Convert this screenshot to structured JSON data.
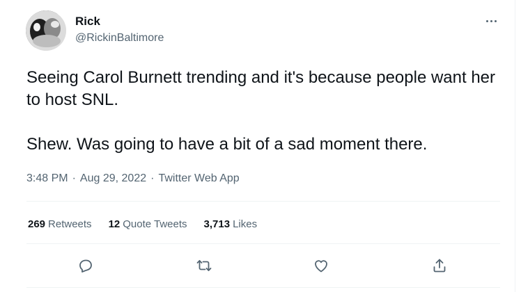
{
  "author": {
    "name": "Rick",
    "handle": "@RickinBaltimore"
  },
  "tweet": {
    "text": "Seeing Carol Burnett trending and it's because people want her to host SNL.\n\nShew. Was going to have a bit of a sad moment there.",
    "time": "3:48 PM",
    "date": "Aug 29, 2022",
    "source": "Twitter Web App",
    "separator": "·"
  },
  "stats": {
    "retweets_count": "269",
    "retweets_label": "Retweets",
    "quotes_count": "12",
    "quotes_label": "Quote Tweets",
    "likes_count": "3,713",
    "likes_label": "Likes"
  },
  "icons": {
    "more": "more-icon",
    "reply": "reply-icon",
    "retweet": "retweet-icon",
    "like": "like-icon",
    "share": "share-icon"
  },
  "colors": {
    "text": "#0f1419",
    "secondary": "#536471",
    "divider": "#eff3f4"
  }
}
